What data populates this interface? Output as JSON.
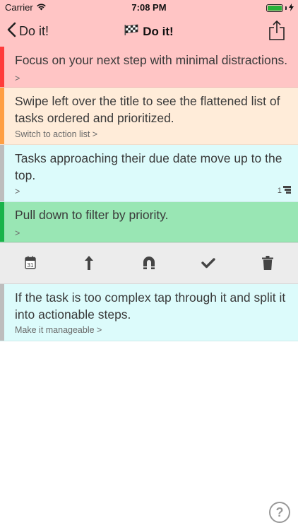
{
  "status": {
    "carrier": "Carrier",
    "time": "7:08 PM"
  },
  "nav": {
    "back_label": "Do it!",
    "title": "Do it!",
    "title_icon": "checkered-flag-icon",
    "share_icon": "share-icon"
  },
  "tasks": [
    {
      "title": "Focus on your next step with minimal distractions.",
      "subtitle": ">",
      "bg": "#ffc5c5",
      "bar": "#ff3b3b"
    },
    {
      "title": "Swipe left over the title to see the flattened list of tasks ordered and prioritized.",
      "subtitle": "Switch to action list >",
      "bg": "#ffecd9",
      "bar": "#ff9f43"
    },
    {
      "title": "Tasks approaching their due date move up to the top.",
      "subtitle": ">",
      "meta": "1",
      "meta_icon": "subtasks-icon",
      "bg": "#dcfbfb",
      "bar": "#bdbdbd"
    },
    {
      "title": "Pull down to filter by priority.",
      "subtitle": ">",
      "bg": "#99e6b4",
      "bar": "#19b34a"
    },
    {
      "title": "If the task is too complex tap through it and split it into actionable steps.",
      "subtitle": "Make it manageable >",
      "bg": "#dcfbfb",
      "bar": "#bdbdbd"
    }
  ],
  "toolbar": {
    "icons": [
      "calendar-icon",
      "move-up-icon",
      "magnet-icon",
      "checkmark-icon",
      "trash-icon"
    ],
    "calendar_day": "31"
  },
  "help": {
    "label": "?"
  }
}
